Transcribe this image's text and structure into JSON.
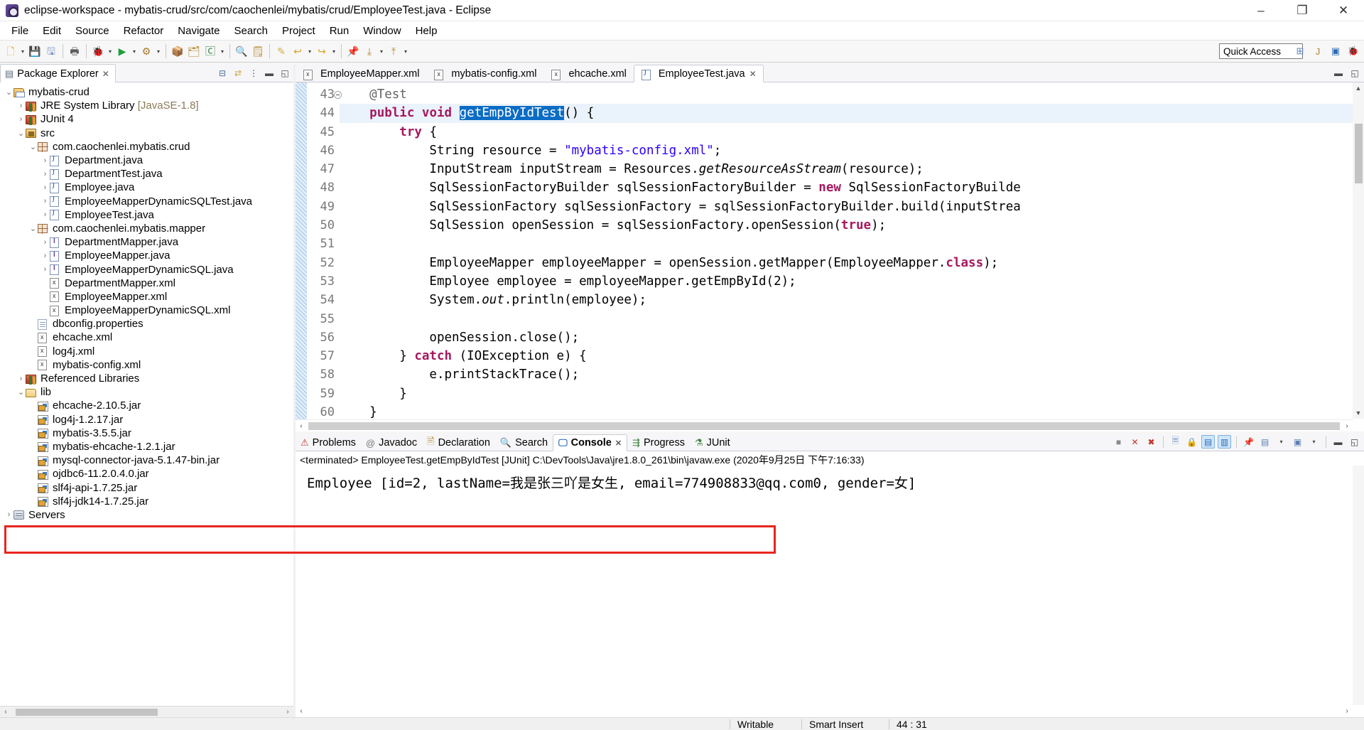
{
  "window": {
    "title": "eclipse-workspace - mybatis-crud/src/com/caochenlei/mybatis/crud/EmployeeTest.java - Eclipse",
    "minimize": "–",
    "maximize": "❐",
    "close": "✕"
  },
  "menu": {
    "items": [
      "File",
      "Edit",
      "Source",
      "Refactor",
      "Navigate",
      "Search",
      "Project",
      "Run",
      "Window",
      "Help"
    ]
  },
  "toolbar": {
    "quick_access_value": "Quick Access"
  },
  "explorer": {
    "tab_label": "Package Explorer",
    "tree": [
      {
        "indent": 0,
        "arrow": "v",
        "icon": "project-icon",
        "label": "mybatis-crud",
        "dim": ""
      },
      {
        "indent": 1,
        "arrow": ">",
        "icon": "library-icon",
        "label": "JRE System Library ",
        "dim": "[JavaSE-1.8]"
      },
      {
        "indent": 1,
        "arrow": ">",
        "icon": "library-icon",
        "label": "JUnit 4",
        "dim": ""
      },
      {
        "indent": 1,
        "arrow": "v",
        "icon": "source-folder-icon",
        "label": "src",
        "dim": ""
      },
      {
        "indent": 2,
        "arrow": "v",
        "icon": "package-icon",
        "label": "com.caochenlei.mybatis.crud",
        "dim": ""
      },
      {
        "indent": 3,
        "arrow": ">",
        "icon": "java-file-icon",
        "label": "Department.java",
        "dim": ""
      },
      {
        "indent": 3,
        "arrow": ">",
        "icon": "java-file-icon",
        "label": "DepartmentTest.java",
        "dim": ""
      },
      {
        "indent": 3,
        "arrow": ">",
        "icon": "java-file-icon",
        "label": "Employee.java",
        "dim": ""
      },
      {
        "indent": 3,
        "arrow": ">",
        "icon": "java-file-icon",
        "label": "EmployeeMapperDynamicSQLTest.java",
        "dim": ""
      },
      {
        "indent": 3,
        "arrow": ">",
        "icon": "java-file-icon",
        "label": "EmployeeTest.java",
        "dim": ""
      },
      {
        "indent": 2,
        "arrow": "v",
        "icon": "package-icon",
        "label": "com.caochenlei.mybatis.mapper",
        "dim": ""
      },
      {
        "indent": 3,
        "arrow": ">",
        "icon": "interface-file-icon",
        "label": "DepartmentMapper.java",
        "dim": ""
      },
      {
        "indent": 3,
        "arrow": ">",
        "icon": "interface-file-icon",
        "label": "EmployeeMapper.java",
        "dim": ""
      },
      {
        "indent": 3,
        "arrow": ">",
        "icon": "interface-file-icon",
        "label": "EmployeeMapperDynamicSQL.java",
        "dim": ""
      },
      {
        "indent": 3,
        "arrow": "",
        "icon": "xml-file-icon",
        "label": "DepartmentMapper.xml",
        "dim": ""
      },
      {
        "indent": 3,
        "arrow": "",
        "icon": "xml-file-icon",
        "label": "EmployeeMapper.xml",
        "dim": ""
      },
      {
        "indent": 3,
        "arrow": "",
        "icon": "xml-file-icon",
        "label": "EmployeeMapperDynamicSQL.xml",
        "dim": ""
      },
      {
        "indent": 2,
        "arrow": "",
        "icon": "properties-file-icon",
        "label": "dbconfig.properties",
        "dim": ""
      },
      {
        "indent": 2,
        "arrow": "",
        "icon": "xml-file-icon",
        "label": "ehcache.xml",
        "dim": ""
      },
      {
        "indent": 2,
        "arrow": "",
        "icon": "xml-file-icon",
        "label": "log4j.xml",
        "dim": ""
      },
      {
        "indent": 2,
        "arrow": "",
        "icon": "xml-file-icon",
        "label": "mybatis-config.xml",
        "dim": ""
      },
      {
        "indent": 1,
        "arrow": ">",
        "icon": "library-icon",
        "label": "Referenced Libraries",
        "dim": ""
      },
      {
        "indent": 1,
        "arrow": "v",
        "icon": "folder-icon",
        "label": "lib",
        "dim": ""
      },
      {
        "indent": 2,
        "arrow": "",
        "icon": "jar-icon",
        "label": "ehcache-2.10.5.jar",
        "dim": ""
      },
      {
        "indent": 2,
        "arrow": "",
        "icon": "jar-icon",
        "label": "log4j-1.2.17.jar",
        "dim": ""
      },
      {
        "indent": 2,
        "arrow": "",
        "icon": "jar-icon",
        "label": "mybatis-3.5.5.jar",
        "dim": ""
      },
      {
        "indent": 2,
        "arrow": "",
        "icon": "jar-icon",
        "label": "mybatis-ehcache-1.2.1.jar",
        "dim": ""
      },
      {
        "indent": 2,
        "arrow": "",
        "icon": "jar-icon",
        "label": "mysql-connector-java-5.1.47-bin.jar",
        "dim": ""
      },
      {
        "indent": 2,
        "arrow": "",
        "icon": "jar-icon",
        "label": "ojdbc6-11.2.0.4.0.jar",
        "dim": ""
      },
      {
        "indent": 2,
        "arrow": "",
        "icon": "jar-icon",
        "label": "slf4j-api-1.7.25.jar",
        "dim": ""
      },
      {
        "indent": 2,
        "arrow": "",
        "icon": "jar-icon",
        "label": "slf4j-jdk14-1.7.25.jar",
        "dim": ""
      },
      {
        "indent": 0,
        "arrow": ">",
        "icon": "servers-icon",
        "label": "Servers",
        "dim": ""
      }
    ]
  },
  "editor": {
    "tabs": [
      {
        "label": "EmployeeMapper.xml",
        "icon": "xml-file-icon",
        "active": false
      },
      {
        "label": "mybatis-config.xml",
        "icon": "xml-file-icon",
        "active": false
      },
      {
        "label": "ehcache.xml",
        "icon": "xml-file-icon",
        "active": false
      },
      {
        "label": "EmployeeTest.java",
        "icon": "java-file-icon",
        "active": true
      }
    ],
    "first_line_number": 43,
    "lines": [
      {
        "num": "43",
        "fold": true,
        "highlight": false
      },
      {
        "num": "44",
        "fold": false,
        "highlight": true
      },
      {
        "num": "45",
        "fold": false,
        "highlight": false
      },
      {
        "num": "46",
        "fold": false,
        "highlight": false
      },
      {
        "num": "47",
        "fold": false,
        "highlight": false
      },
      {
        "num": "48",
        "fold": false,
        "highlight": false
      },
      {
        "num": "49",
        "fold": false,
        "highlight": false
      },
      {
        "num": "50",
        "fold": false,
        "highlight": false
      },
      {
        "num": "51",
        "fold": false,
        "highlight": false
      },
      {
        "num": "52",
        "fold": false,
        "highlight": false
      },
      {
        "num": "53",
        "fold": false,
        "highlight": false
      },
      {
        "num": "54",
        "fold": false,
        "highlight": false
      },
      {
        "num": "55",
        "fold": false,
        "highlight": false
      },
      {
        "num": "56",
        "fold": false,
        "highlight": false
      },
      {
        "num": "57",
        "fold": false,
        "highlight": false
      },
      {
        "num": "58",
        "fold": false,
        "highlight": false
      },
      {
        "num": "59",
        "fold": false,
        "highlight": false
      },
      {
        "num": "60",
        "fold": false,
        "highlight": false
      }
    ],
    "code_text": [
      "    @Test",
      "    public void getEmpByIdTest() {",
      "        try {",
      "            String resource = \"mybatis-config.xml\";",
      "            InputStream inputStream = Resources.getResourceAsStream(resource);",
      "            SqlSessionFactoryBuilder sqlSessionFactoryBuilder = new SqlSessionFactoryBuilde",
      "            SqlSessionFactory sqlSessionFactory = sqlSessionFactoryBuilder.build(inputStrea",
      "            SqlSession openSession = sqlSessionFactory.openSession(true);",
      "",
      "            EmployeeMapper employeeMapper = openSession.getMapper(EmployeeMapper.class);",
      "            Employee employee = employeeMapper.getEmpById(2);",
      "            System.out.println(employee);",
      "",
      "            openSession.close();",
      "        } catch (IOException e) {",
      "            e.printStackTrace();",
      "        }",
      "    }"
    ],
    "selected_token": "getEmpByIdTest"
  },
  "console": {
    "tabs": [
      {
        "label": "Problems",
        "icon": "problems-icon",
        "active": false
      },
      {
        "label": "Javadoc",
        "icon": "javadoc-icon",
        "active": false
      },
      {
        "label": "Declaration",
        "icon": "declaration-icon",
        "active": false
      },
      {
        "label": "Search",
        "icon": "search-icon",
        "active": false
      },
      {
        "label": "Console",
        "icon": "console-icon",
        "active": true
      },
      {
        "label": "Progress",
        "icon": "progress-icon",
        "active": false
      },
      {
        "label": "JUnit",
        "icon": "junit-icon",
        "active": false
      }
    ],
    "header": "<terminated> EmployeeTest.getEmpByIdTest [JUnit] C:\\DevTools\\Java\\jre1.8.0_261\\bin\\javaw.exe (2020年9月25日 下午7:16:33)",
    "output": "Employee [id=2, lastName=我是张三吖是女生, email=774908833@qq.com0, gender=女]",
    "highlight_color": "#e8251f"
  },
  "statusbar": {
    "writable": "Writable",
    "insert_mode": "Smart Insert",
    "position": "44 : 31"
  }
}
